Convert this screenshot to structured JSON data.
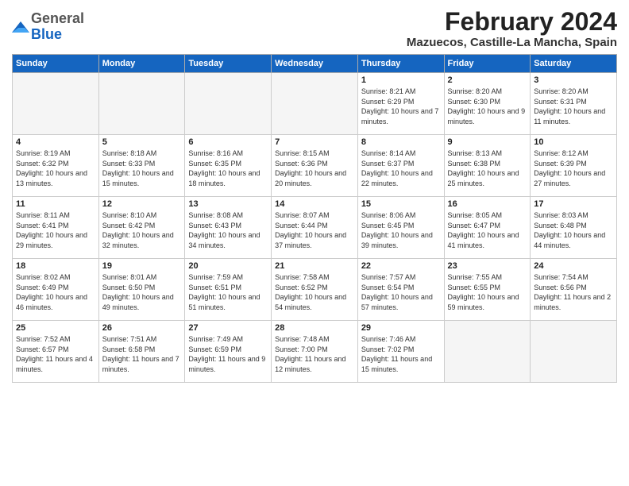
{
  "header": {
    "logo_general": "General",
    "logo_blue": "Blue",
    "month_title": "February 2024",
    "location": "Mazuecos, Castille-La Mancha, Spain"
  },
  "weekdays": [
    "Sunday",
    "Monday",
    "Tuesday",
    "Wednesday",
    "Thursday",
    "Friday",
    "Saturday"
  ],
  "weeks": [
    [
      {
        "day": "",
        "empty": true
      },
      {
        "day": "",
        "empty": true
      },
      {
        "day": "",
        "empty": true
      },
      {
        "day": "",
        "empty": true
      },
      {
        "day": "1",
        "sunrise": "8:21 AM",
        "sunset": "6:29 PM",
        "daylight": "10 hours and 7 minutes."
      },
      {
        "day": "2",
        "sunrise": "8:20 AM",
        "sunset": "6:30 PM",
        "daylight": "10 hours and 9 minutes."
      },
      {
        "day": "3",
        "sunrise": "8:20 AM",
        "sunset": "6:31 PM",
        "daylight": "10 hours and 11 minutes."
      }
    ],
    [
      {
        "day": "4",
        "sunrise": "8:19 AM",
        "sunset": "6:32 PM",
        "daylight": "10 hours and 13 minutes."
      },
      {
        "day": "5",
        "sunrise": "8:18 AM",
        "sunset": "6:33 PM",
        "daylight": "10 hours and 15 minutes."
      },
      {
        "day": "6",
        "sunrise": "8:16 AM",
        "sunset": "6:35 PM",
        "daylight": "10 hours and 18 minutes."
      },
      {
        "day": "7",
        "sunrise": "8:15 AM",
        "sunset": "6:36 PM",
        "daylight": "10 hours and 20 minutes."
      },
      {
        "day": "8",
        "sunrise": "8:14 AM",
        "sunset": "6:37 PM",
        "daylight": "10 hours and 22 minutes."
      },
      {
        "day": "9",
        "sunrise": "8:13 AM",
        "sunset": "6:38 PM",
        "daylight": "10 hours and 25 minutes."
      },
      {
        "day": "10",
        "sunrise": "8:12 AM",
        "sunset": "6:39 PM",
        "daylight": "10 hours and 27 minutes."
      }
    ],
    [
      {
        "day": "11",
        "sunrise": "8:11 AM",
        "sunset": "6:41 PM",
        "daylight": "10 hours and 29 minutes."
      },
      {
        "day": "12",
        "sunrise": "8:10 AM",
        "sunset": "6:42 PM",
        "daylight": "10 hours and 32 minutes."
      },
      {
        "day": "13",
        "sunrise": "8:08 AM",
        "sunset": "6:43 PM",
        "daylight": "10 hours and 34 minutes."
      },
      {
        "day": "14",
        "sunrise": "8:07 AM",
        "sunset": "6:44 PM",
        "daylight": "10 hours and 37 minutes."
      },
      {
        "day": "15",
        "sunrise": "8:06 AM",
        "sunset": "6:45 PM",
        "daylight": "10 hours and 39 minutes."
      },
      {
        "day": "16",
        "sunrise": "8:05 AM",
        "sunset": "6:47 PM",
        "daylight": "10 hours and 41 minutes."
      },
      {
        "day": "17",
        "sunrise": "8:03 AM",
        "sunset": "6:48 PM",
        "daylight": "10 hours and 44 minutes."
      }
    ],
    [
      {
        "day": "18",
        "sunrise": "8:02 AM",
        "sunset": "6:49 PM",
        "daylight": "10 hours and 46 minutes."
      },
      {
        "day": "19",
        "sunrise": "8:01 AM",
        "sunset": "6:50 PM",
        "daylight": "10 hours and 49 minutes."
      },
      {
        "day": "20",
        "sunrise": "7:59 AM",
        "sunset": "6:51 PM",
        "daylight": "10 hours and 51 minutes."
      },
      {
        "day": "21",
        "sunrise": "7:58 AM",
        "sunset": "6:52 PM",
        "daylight": "10 hours and 54 minutes."
      },
      {
        "day": "22",
        "sunrise": "7:57 AM",
        "sunset": "6:54 PM",
        "daylight": "10 hours and 57 minutes."
      },
      {
        "day": "23",
        "sunrise": "7:55 AM",
        "sunset": "6:55 PM",
        "daylight": "10 hours and 59 minutes."
      },
      {
        "day": "24",
        "sunrise": "7:54 AM",
        "sunset": "6:56 PM",
        "daylight": "11 hours and 2 minutes."
      }
    ],
    [
      {
        "day": "25",
        "sunrise": "7:52 AM",
        "sunset": "6:57 PM",
        "daylight": "11 hours and 4 minutes."
      },
      {
        "day": "26",
        "sunrise": "7:51 AM",
        "sunset": "6:58 PM",
        "daylight": "11 hours and 7 minutes."
      },
      {
        "day": "27",
        "sunrise": "7:49 AM",
        "sunset": "6:59 PM",
        "daylight": "11 hours and 9 minutes."
      },
      {
        "day": "28",
        "sunrise": "7:48 AM",
        "sunset": "7:00 PM",
        "daylight": "11 hours and 12 minutes."
      },
      {
        "day": "29",
        "sunrise": "7:46 AM",
        "sunset": "7:02 PM",
        "daylight": "11 hours and 15 minutes."
      },
      {
        "day": "",
        "empty": true
      },
      {
        "day": "",
        "empty": true
      }
    ]
  ]
}
